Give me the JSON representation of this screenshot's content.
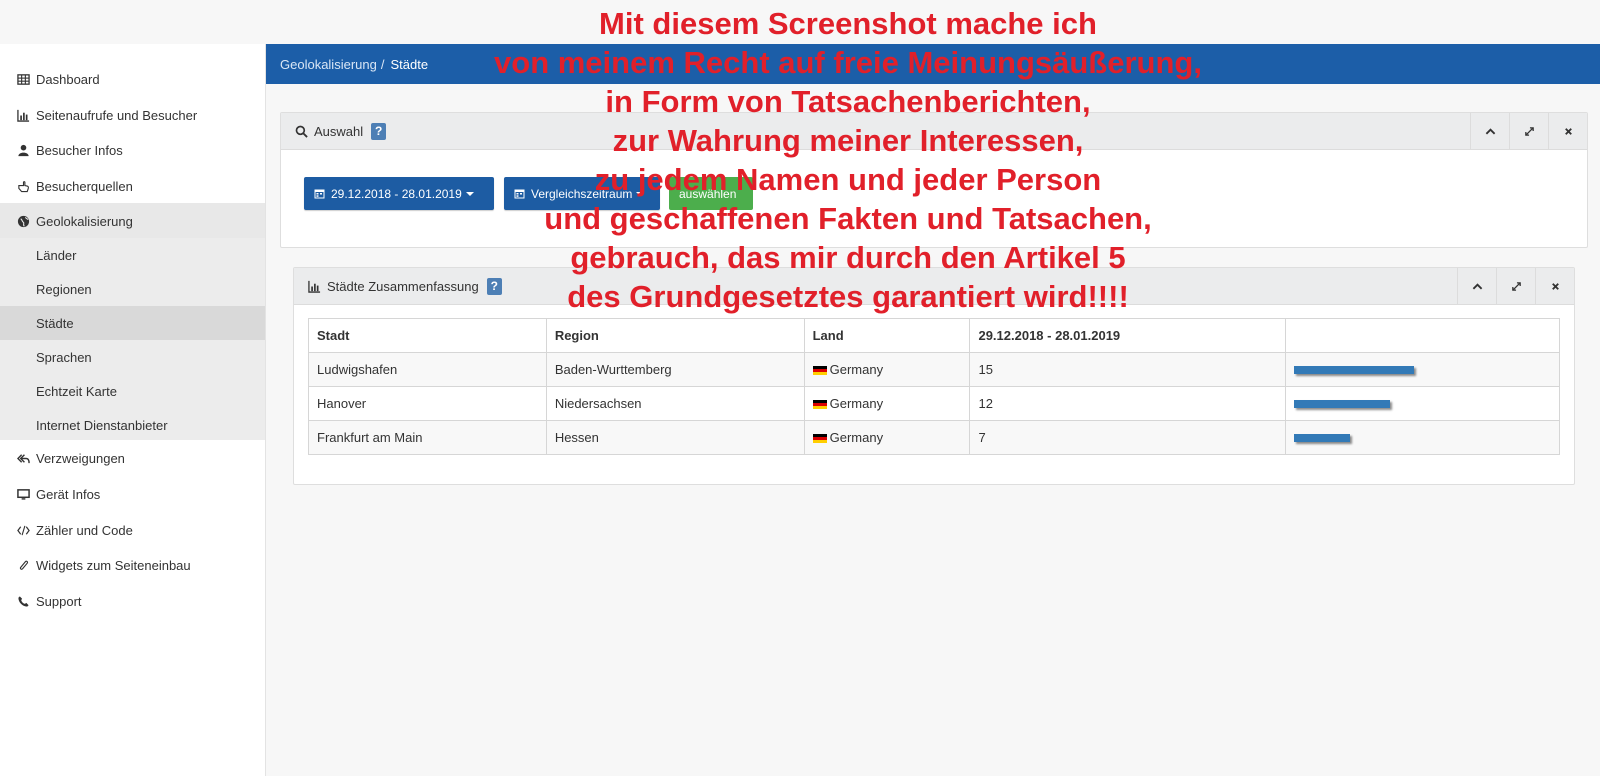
{
  "sidebar": {
    "items": [
      {
        "label": "Dashboard",
        "icon": "table-icon"
      },
      {
        "label": "Seitenaufrufe und Besucher",
        "icon": "bar-chart-icon"
      },
      {
        "label": "Besucher Infos",
        "icon": "user-icon"
      },
      {
        "label": "Besucherquellen",
        "icon": "hand-pointer-icon"
      },
      {
        "label": "Geolokalisierung",
        "icon": "globe-icon"
      },
      {
        "label": "Verzweigungen",
        "icon": "reply-all-icon"
      },
      {
        "label": "Gerät Infos",
        "icon": "monitor-icon"
      },
      {
        "label": "Zähler und Code",
        "icon": "code-icon"
      },
      {
        "label": "Widgets zum Seiteneinbau",
        "icon": "paperclip-icon"
      },
      {
        "label": "Support",
        "icon": "phone-icon"
      }
    ],
    "sub_items": [
      {
        "label": "Länder"
      },
      {
        "label": "Regionen"
      },
      {
        "label": "Städte"
      },
      {
        "label": "Sprachen"
      },
      {
        "label": "Echtzeit Karte"
      },
      {
        "label": "Internet Dienstanbieter"
      }
    ]
  },
  "breadcrumb": {
    "parent": "Geolokalisierung",
    "separator": "/",
    "current": "Städte"
  },
  "selection_panel": {
    "title": "Auswahl",
    "help": "?",
    "date_range_button": "29.12.2018 - 28.01.2019",
    "compare_button": "Vergleichszeitraum",
    "select_button": "auswählen"
  },
  "summary_panel": {
    "title": "Städte Zusammenfassung",
    "help": "?",
    "columns": [
      "Stadt",
      "Region",
      "Land",
      "29.12.2018 - 28.01.2019",
      ""
    ],
    "rows": [
      {
        "city": "Ludwigshafen",
        "region": "Baden-Wurttemberg",
        "country": "Germany",
        "visits": "15",
        "share": 1.0
      },
      {
        "city": "Hanover",
        "region": "Niedersachsen",
        "country": "Germany",
        "visits": "12",
        "share": 0.8
      },
      {
        "city": "Frankfurt am Main",
        "region": "Hessen",
        "country": "Germany",
        "visits": "7",
        "share": 0.47
      }
    ]
  },
  "overlay_text": [
    "Mit diesem Screenshot mache ich",
    "von meinem Recht auf freie Meinungsäußerung,",
    "in Form von Tatsachenberichten,",
    "zur Wahrung meiner Interessen,",
    "zu jedem Namen und jeder Person",
    "und geschaffenen Fakten und Tatsachen,",
    "gebrauch, das mir durch den Artikel 5",
    "des Grundgesetztes garantiert wird!!!!"
  ],
  "colors": {
    "accent": "#1c5ea8",
    "bar": "#337ab7",
    "overlay": "#e1202a",
    "select_button": "#4cae4c"
  }
}
